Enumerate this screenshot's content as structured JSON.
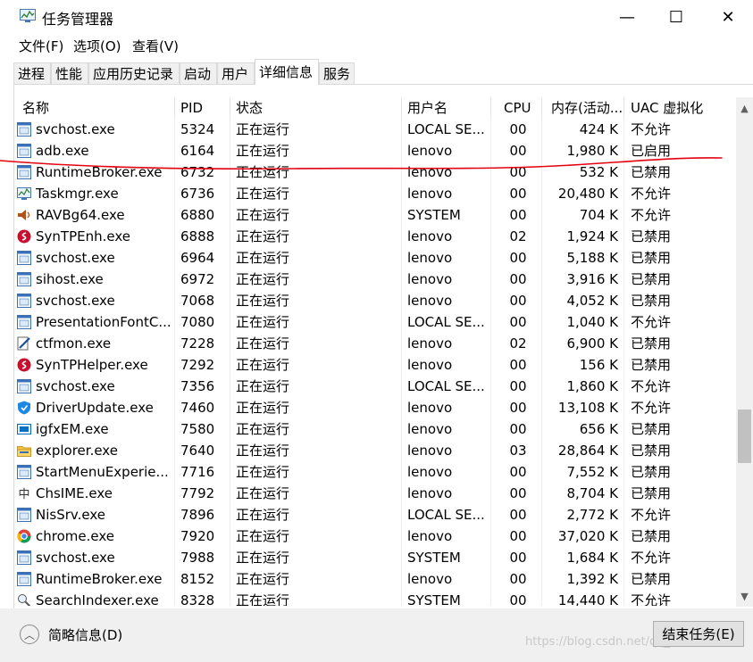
{
  "window": {
    "title": "任务管理器",
    "minimize_glyph": "—",
    "maximize_glyph": "☐",
    "close_glyph": "✕"
  },
  "menu": [
    {
      "label": "文件(F)"
    },
    {
      "label": "选项(O)"
    },
    {
      "label": "查看(V)"
    }
  ],
  "tabs": [
    {
      "label": "进程"
    },
    {
      "label": "性能"
    },
    {
      "label": "应用历史记录"
    },
    {
      "label": "启动"
    },
    {
      "label": "用户"
    },
    {
      "label": "详细信息",
      "active": true
    },
    {
      "label": "服务"
    }
  ],
  "table": {
    "headers": [
      "名称",
      "PID",
      "状态",
      "用户名",
      "CPU",
      "内存(活动...",
      "UAC 虚拟化"
    ],
    "sort_indicator": "^",
    "rows": [
      {
        "name": "svchost.exe",
        "icon": "service-host-icon",
        "pid": "5324",
        "status": "正在运行",
        "user": "LOCAL SE...",
        "cpu": "00",
        "mem": "424 K",
        "uac": "不允许"
      },
      {
        "name": "adb.exe",
        "icon": "console-app-icon",
        "pid": "6164",
        "status": "正在运行",
        "user": "lenovo",
        "cpu": "00",
        "mem": "1,980 K",
        "uac": "已启用"
      },
      {
        "name": "RuntimeBroker.exe",
        "icon": "service-host-icon",
        "pid": "6732",
        "status": "正在运行",
        "user": "lenovo",
        "cpu": "00",
        "mem": "532 K",
        "uac": "已禁用"
      },
      {
        "name": "Taskmgr.exe",
        "icon": "task-manager-icon",
        "pid": "6736",
        "status": "正在运行",
        "user": "lenovo",
        "cpu": "00",
        "mem": "20,480 K",
        "uac": "不允许"
      },
      {
        "name": "RAVBg64.exe",
        "icon": "speaker-icon",
        "pid": "6880",
        "status": "正在运行",
        "user": "SYSTEM",
        "cpu": "00",
        "mem": "704 K",
        "uac": "不允许"
      },
      {
        "name": "SynTPEnh.exe",
        "icon": "synaptics-icon",
        "pid": "6888",
        "status": "正在运行",
        "user": "lenovo",
        "cpu": "02",
        "mem": "1,924 K",
        "uac": "已禁用"
      },
      {
        "name": "svchost.exe",
        "icon": "service-host-icon",
        "pid": "6964",
        "status": "正在运行",
        "user": "lenovo",
        "cpu": "00",
        "mem": "5,188 K",
        "uac": "已禁用"
      },
      {
        "name": "sihost.exe",
        "icon": "service-host-icon",
        "pid": "6972",
        "status": "正在运行",
        "user": "lenovo",
        "cpu": "00",
        "mem": "3,916 K",
        "uac": "已禁用"
      },
      {
        "name": "svchost.exe",
        "icon": "service-host-icon",
        "pid": "7068",
        "status": "正在运行",
        "user": "lenovo",
        "cpu": "00",
        "mem": "4,052 K",
        "uac": "已禁用"
      },
      {
        "name": "PresentationFontC...",
        "icon": "service-host-icon",
        "pid": "7080",
        "status": "正在运行",
        "user": "LOCAL SE...",
        "cpu": "00",
        "mem": "1,040 K",
        "uac": "不允许"
      },
      {
        "name": "ctfmon.exe",
        "icon": "pen-icon",
        "pid": "7228",
        "status": "正在运行",
        "user": "lenovo",
        "cpu": "02",
        "mem": "6,900 K",
        "uac": "已禁用"
      },
      {
        "name": "SynTPHelper.exe",
        "icon": "synaptics-icon",
        "pid": "7292",
        "status": "正在运行",
        "user": "lenovo",
        "cpu": "00",
        "mem": "156 K",
        "uac": "已禁用"
      },
      {
        "name": "svchost.exe",
        "icon": "service-host-icon",
        "pid": "7356",
        "status": "正在运行",
        "user": "LOCAL SE...",
        "cpu": "00",
        "mem": "1,860 K",
        "uac": "不允许"
      },
      {
        "name": "DriverUpdate.exe",
        "icon": "shield-icon",
        "pid": "7460",
        "status": "正在运行",
        "user": "lenovo",
        "cpu": "00",
        "mem": "13,108 K",
        "uac": "不允许"
      },
      {
        "name": "igfxEM.exe",
        "icon": "intel-graphics-icon",
        "pid": "7580",
        "status": "正在运行",
        "user": "lenovo",
        "cpu": "00",
        "mem": "656 K",
        "uac": "已禁用"
      },
      {
        "name": "explorer.exe",
        "icon": "folder-icon",
        "pid": "7640",
        "status": "正在运行",
        "user": "lenovo",
        "cpu": "03",
        "mem": "28,864 K",
        "uac": "已禁用"
      },
      {
        "name": "StartMenuExperie...",
        "icon": "service-host-icon",
        "pid": "7716",
        "status": "正在运行",
        "user": "lenovo",
        "cpu": "00",
        "mem": "7,552 K",
        "uac": "已禁用"
      },
      {
        "name": "ChsIME.exe",
        "icon": "ime-icon",
        "pid": "7792",
        "status": "正在运行",
        "user": "lenovo",
        "cpu": "00",
        "mem": "8,704 K",
        "uac": "已禁用"
      },
      {
        "name": "NisSrv.exe",
        "icon": "service-host-icon",
        "pid": "7896",
        "status": "正在运行",
        "user": "LOCAL SE...",
        "cpu": "00",
        "mem": "2,772 K",
        "uac": "不允许"
      },
      {
        "name": "chrome.exe",
        "icon": "chrome-icon",
        "pid": "7920",
        "status": "正在运行",
        "user": "lenovo",
        "cpu": "00",
        "mem": "37,020 K",
        "uac": "已禁用"
      },
      {
        "name": "svchost.exe",
        "icon": "service-host-icon",
        "pid": "7988",
        "status": "正在运行",
        "user": "SYSTEM",
        "cpu": "00",
        "mem": "1,684 K",
        "uac": "不允许"
      },
      {
        "name": "RuntimeBroker.exe",
        "icon": "service-host-icon",
        "pid": "8152",
        "status": "正在运行",
        "user": "lenovo",
        "cpu": "00",
        "mem": "1,392 K",
        "uac": "已禁用"
      },
      {
        "name": "SearchIndexer.exe",
        "icon": "search-indexer-icon",
        "pid": "8328",
        "status": "正在运行",
        "user": "SYSTEM",
        "cpu": "00",
        "mem": "14,440 K",
        "uac": "不允许"
      }
    ]
  },
  "footer": {
    "fewer_details": "简略信息(D)",
    "end_task": "结束任务(E)",
    "watermark": "https://blog.csdn.net/qq_4...49"
  },
  "colors": {
    "annotation_stroke": "#e3000f",
    "synaptics": "#c8102e",
    "shield": "#1e88e5"
  }
}
